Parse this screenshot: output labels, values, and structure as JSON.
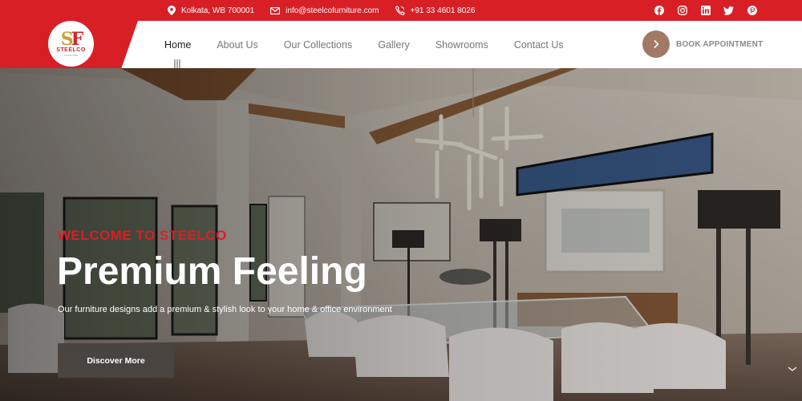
{
  "topbar": {
    "location": "Kolkata, WB 700001",
    "email": "info@steelcofurniture.com",
    "phone": "+91 33 4601 8026",
    "social_icons": [
      "facebook-icon",
      "instagram-icon",
      "linkedin-icon",
      "twitter-icon",
      "pinterest-icon"
    ]
  },
  "logo": {
    "mark_s": "S",
    "mark_f": "F",
    "text": "STEELCO",
    "tagline": "FURNITURE"
  },
  "nav": {
    "items": [
      {
        "label": "Home",
        "active": true
      },
      {
        "label": "About Us"
      },
      {
        "label": "Our Collections"
      },
      {
        "label": "Gallery"
      },
      {
        "label": "Showrooms"
      },
      {
        "label": "Contact Us"
      }
    ]
  },
  "cta": {
    "book_label": "BOOK APPOINTMENT"
  },
  "hero": {
    "welcome": "WELCOME TO STEELCO",
    "headline": "Premium Feeling",
    "subline": "Our furniture designs add a premium & stylish look to your home & office environment",
    "button_label": "Discover More"
  },
  "colors": {
    "brand_red": "#d81f26",
    "accent_brown": "#a07a66",
    "button_dark": "#4a4441"
  }
}
